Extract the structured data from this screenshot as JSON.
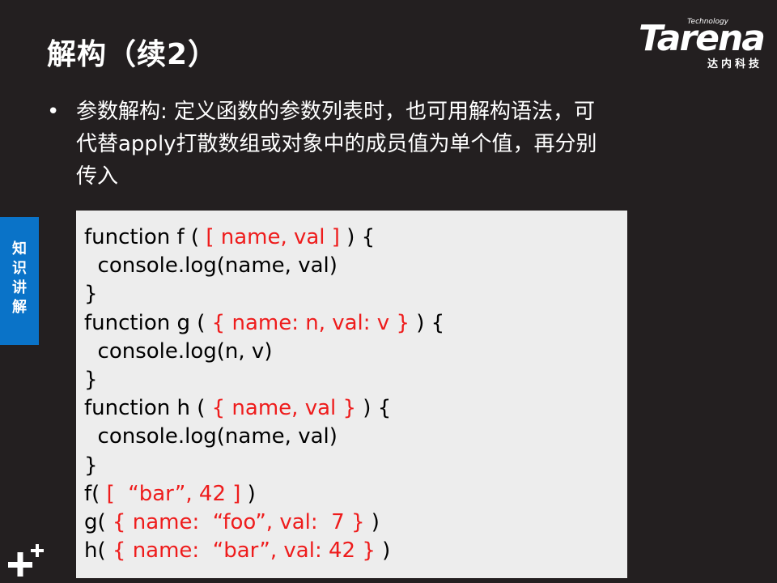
{
  "title": "解构（续2）",
  "logo": {
    "word": "Tarena",
    "tag": "Technology",
    "cn": "达内科技"
  },
  "sidebar": {
    "label": "知识讲解"
  },
  "bullet": {
    "symbol": "•",
    "lines": [
      "参数解构: 定义函数的参数列表时，也可用解构语法，可",
      "代替apply打散数组或对象中的成员值为单个值，再分别",
      "传入"
    ]
  },
  "code": {
    "lines": [
      [
        {
          "t": "function f ( ",
          "c": "k"
        },
        {
          "t": "[ name, val ]",
          "c": "r"
        },
        {
          "t": " ) {",
          "c": "k"
        }
      ],
      [
        {
          "t": "  console.log(name, val)",
          "c": "k"
        }
      ],
      [
        {
          "t": "}",
          "c": "k"
        }
      ],
      [
        {
          "t": "function g ( ",
          "c": "k"
        },
        {
          "t": "{ name: n, val: v }",
          "c": "r"
        },
        {
          "t": " ) {",
          "c": "k"
        }
      ],
      [
        {
          "t": "  console.log(n, v)",
          "c": "k"
        }
      ],
      [
        {
          "t": "}",
          "c": "k"
        }
      ],
      [
        {
          "t": "function h ( ",
          "c": "k"
        },
        {
          "t": "{ name, val }",
          "c": "r"
        },
        {
          "t": " ) {",
          "c": "k"
        }
      ],
      [
        {
          "t": "  console.log(name, val)",
          "c": "k"
        }
      ],
      [
        {
          "t": "}",
          "c": "k"
        }
      ],
      [
        {
          "t": "f( ",
          "c": "k"
        },
        {
          "t": "[  “bar”, 42 ]",
          "c": "r"
        },
        {
          "t": " )",
          "c": "k"
        }
      ],
      [
        {
          "t": "g( ",
          "c": "k"
        },
        {
          "t": "{ name:  “foo”, val:  7 }",
          "c": "r"
        },
        {
          "t": " )",
          "c": "k"
        }
      ],
      [
        {
          "t": "h( ",
          "c": "k"
        },
        {
          "t": "{ name:  “bar”, val: 42 }",
          "c": "r"
        },
        {
          "t": " )",
          "c": "k"
        }
      ]
    ]
  },
  "colors": {
    "background": "#231f20",
    "sidebar": "#0a73c8",
    "code_background": "#ededed",
    "code_highlight": "#ee1c1c"
  },
  "icons": {
    "corner": "plus-plus-icon"
  }
}
